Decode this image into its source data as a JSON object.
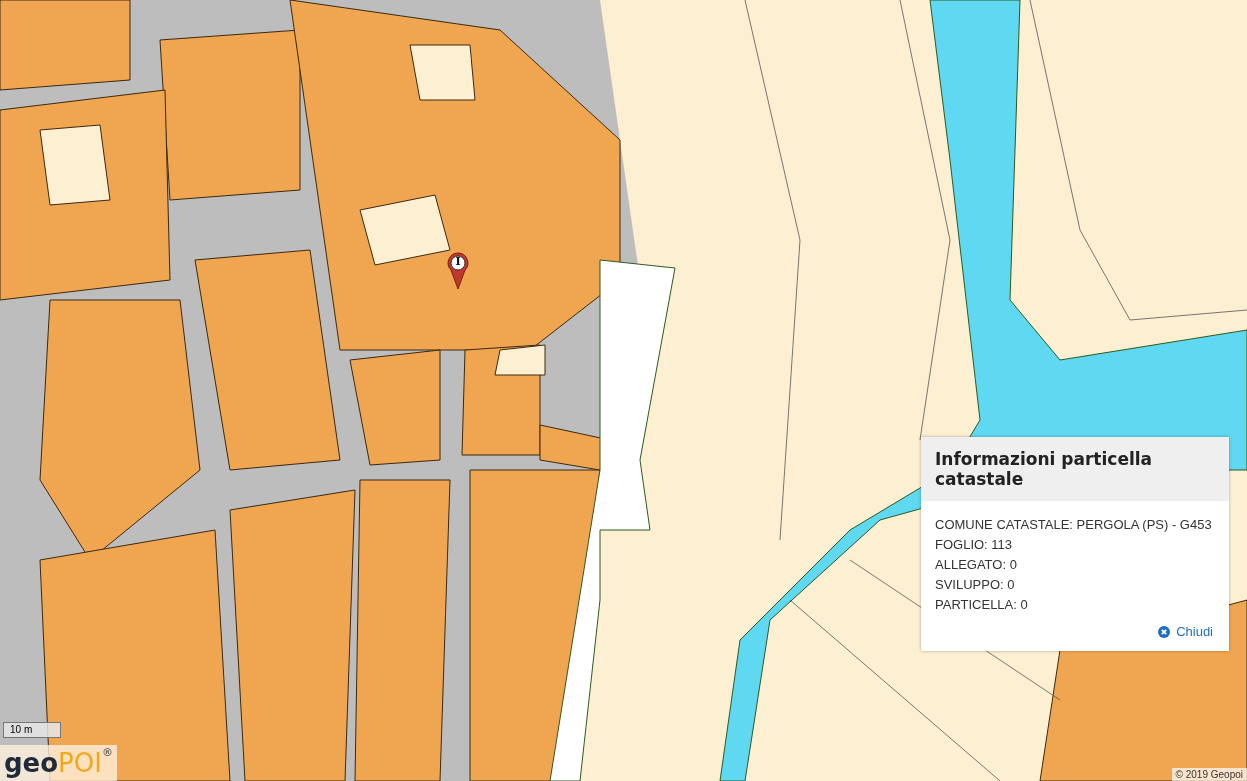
{
  "map": {
    "marker": {
      "label": "I"
    },
    "scale_bar": {
      "label": "10 m"
    },
    "logo": {
      "part_1": "geo",
      "part_2": "POI",
      "mark": "®"
    },
    "attribution": "© 2019 Geopoi"
  },
  "popup": {
    "title": "Informazioni particella catastale",
    "fields": [
      "COMUNE CATASTALE: PERGOLA (PS) - G453",
      "FOGLIO: 113",
      "ALLEGATO: 0",
      "SVILUPPO: 0",
      "PARTICELLA: 0"
    ],
    "close_label": "Chiudi"
  }
}
